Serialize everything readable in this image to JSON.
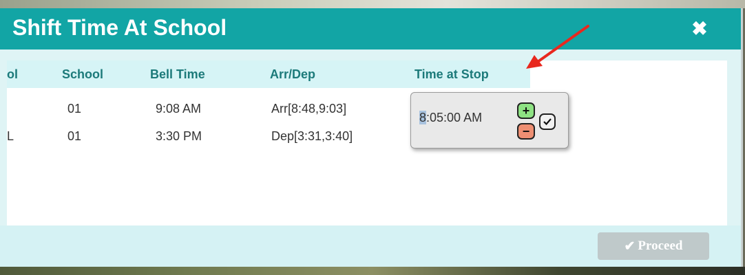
{
  "modal": {
    "title": "Shift Time At School",
    "close_glyph": "✖",
    "close_icon": "close-icon"
  },
  "table": {
    "columns": [
      "ol",
      "School",
      "Bell Time",
      "Arr/Dep",
      "Time at Stop"
    ],
    "rows": [
      {
        "lead": "",
        "school": "01",
        "bell_time": "9:08 AM",
        "arr_dep": "Arr[8:48,9:03]"
      },
      {
        "lead": "L",
        "school": "01",
        "bell_time": "3:30 PM",
        "arr_dep": "Dep[3:31,3:40]"
      }
    ]
  },
  "time_editor": {
    "selected_part": "8",
    "rest": ":05:00 AM",
    "plus_glyph": "+",
    "minus_glyph": "−",
    "icons": [
      "plus-icon",
      "minus-icon",
      "check-icon"
    ]
  },
  "footer": {
    "proceed_label": "Proceed",
    "proceed_icon": "check-icon",
    "proceed_glyph": "✔"
  },
  "colors": {
    "header": "#12a5a5",
    "table_header": "#d6f4f6",
    "footer": "#d5f2f4",
    "plus": "#8ee283",
    "minus": "#ee8f73",
    "arrow": "#e8281e"
  }
}
